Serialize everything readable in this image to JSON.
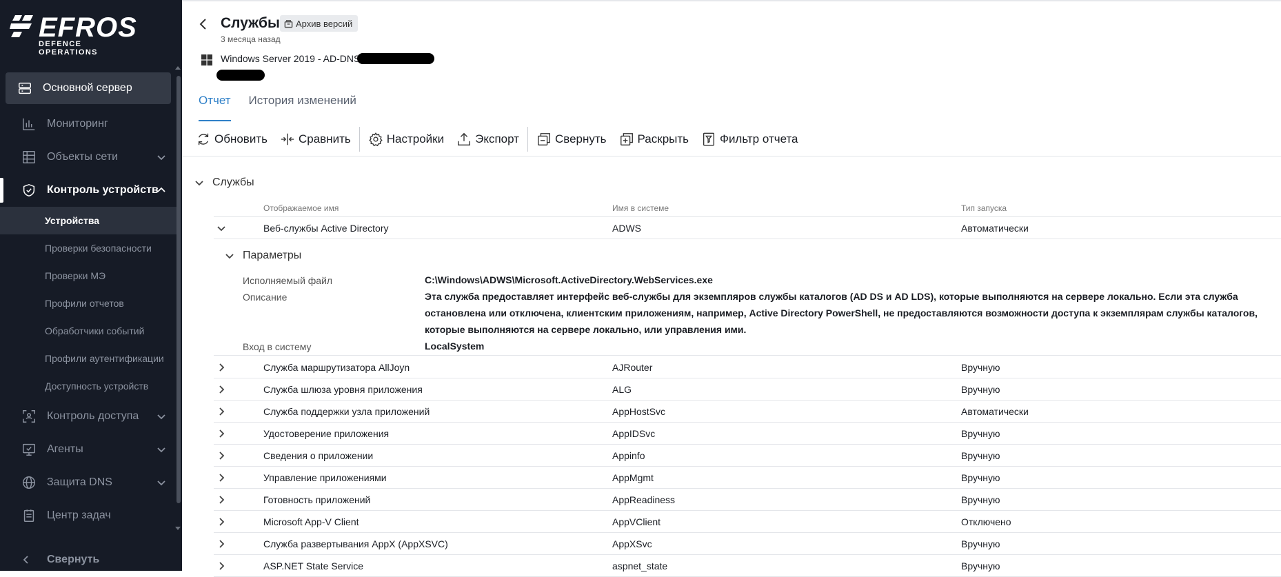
{
  "app": {
    "logo_main": "EFROS",
    "logo_sub": "DEFENCE OPERATIONS"
  },
  "sidebar": {
    "items": [
      {
        "label": "Основной сервер",
        "icon": "server-icon"
      },
      {
        "label": "Мониторинг",
        "icon": "chart-icon"
      },
      {
        "label": "Объекты сети",
        "icon": "network-icon"
      },
      {
        "label": "Контроль устройств",
        "icon": "shield-check-icon"
      },
      {
        "label": "Контроль доступа",
        "icon": "scan-icon"
      },
      {
        "label": "Агенты",
        "icon": "monitor-check-icon"
      },
      {
        "label": "Защита DNS",
        "icon": "globe-icon"
      },
      {
        "label": "Центр задач",
        "icon": "clipboard-icon"
      }
    ],
    "subitems": [
      "Устройства",
      "Проверки безопасности",
      "Проверки МЭ",
      "Профили отчетов",
      "Обработчики событий",
      "Профили аутентификации",
      "Доступность устройств"
    ],
    "collapse_label": "Свернуть"
  },
  "header": {
    "title": "Службы",
    "archive_label": "Архив версий",
    "time_ago": "3 месяца назад",
    "host": "Windows Server 2019 - AD-DNS"
  },
  "tabs": [
    {
      "label": "Отчет",
      "active": true
    },
    {
      "label": "История изменений",
      "active": false
    }
  ],
  "toolbar": {
    "refresh": "Обновить",
    "compare": "Сравнить",
    "settings": "Настройки",
    "export": "Экспорт",
    "collapse": "Свернуть",
    "expand": "Раскрыть",
    "filter": "Фильтр отчета"
  },
  "section": {
    "title": "Службы",
    "columns": [
      "Отображаемое имя",
      "Имя в системе",
      "Тип запуска"
    ]
  },
  "expanded_row": {
    "display": "Веб-службы Active Directory",
    "system": "ADWS",
    "start": "Автоматически",
    "params_title": "Параметры",
    "params": [
      {
        "label": "Исполняемый файл",
        "value": "C:\\Windows\\ADWS\\Microsoft.ActiveDirectory.WebServices.exe"
      },
      {
        "label": "Описание",
        "value": "Эта служба предоставляет интерфейс веб-службы для экземпляров службы каталогов (AD DS и AD LDS), которые выполняются на сервере локально. Если эта служба остановлена или отключена, клиентским приложениям, например, Active Directory PowerShell, не предоставляются возможности доступа к экземплярам службы каталогов, которые выполняются на сервере локально, или управления ими."
      },
      {
        "label": "Вход в систему",
        "value": "LocalSystem"
      }
    ]
  },
  "rows": [
    {
      "display": "Служба маршрутизатора AllJoyn",
      "system": "AJRouter",
      "start": "Вручную"
    },
    {
      "display": "Служба шлюза уровня приложения",
      "system": "ALG",
      "start": "Вручную"
    },
    {
      "display": "Служба поддержки узла приложений",
      "system": "AppHostSvc",
      "start": "Автоматически"
    },
    {
      "display": "Удостоверение приложения",
      "system": "AppIDSvc",
      "start": "Вручную"
    },
    {
      "display": "Сведения о приложении",
      "system": "Appinfo",
      "start": "Вручную"
    },
    {
      "display": "Управление приложениями",
      "system": "AppMgmt",
      "start": "Вручную"
    },
    {
      "display": "Готовность приложений",
      "system": "AppReadiness",
      "start": "Вручную"
    },
    {
      "display": "Microsoft App-V Client",
      "system": "AppVClient",
      "start": "Отключено"
    },
    {
      "display": "Служба развертывания AppX (AppXSVC)",
      "system": "AppXSvc",
      "start": "Вручную"
    },
    {
      "display": "ASP.NET State Service",
      "system": "aspnet_state",
      "start": "Вручную"
    }
  ],
  "colors": {
    "sidebar_bg": "#161b26",
    "accent": "#2f80c8"
  }
}
